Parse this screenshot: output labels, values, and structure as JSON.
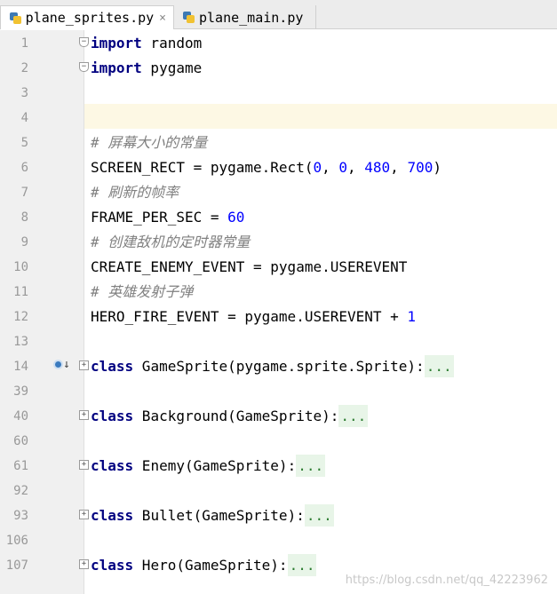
{
  "tabs": [
    {
      "label": "plane_sprites.py",
      "active": true,
      "closable": true,
      "icon": "python-file-icon"
    },
    {
      "label": "plane_main.py",
      "active": false,
      "closable": false,
      "icon": "python-file-icon"
    }
  ],
  "tab_close_glyph": "×",
  "lines": [
    {
      "n": "1",
      "text": "import random"
    },
    {
      "n": "2",
      "text": "import pygame"
    },
    {
      "n": "3",
      "text": ""
    },
    {
      "n": "4",
      "text": ""
    },
    {
      "n": "5",
      "text": "# 屏幕大小的常量"
    },
    {
      "n": "6",
      "text": "SCREEN_RECT = pygame.Rect(0, 0, 480, 700)"
    },
    {
      "n": "7",
      "text": "# 刷新的帧率"
    },
    {
      "n": "8",
      "text": "FRAME_PER_SEC = 60"
    },
    {
      "n": "9",
      "text": "# 创建敌机的定时器常量"
    },
    {
      "n": "10",
      "text": "CREATE_ENEMY_EVENT = pygame.USEREVENT"
    },
    {
      "n": "11",
      "text": "# 英雄发射子弹"
    },
    {
      "n": "12",
      "text": "HERO_FIRE_EVENT = pygame.USEREVENT + 1"
    },
    {
      "n": "13",
      "text": ""
    },
    {
      "n": "14",
      "text": "class GameSprite(pygame.sprite.Sprite):..."
    },
    {
      "n": "39",
      "text": ""
    },
    {
      "n": "40",
      "text": "class Background(GameSprite):..."
    },
    {
      "n": "60",
      "text": ""
    },
    {
      "n": "61",
      "text": "class Enemy(GameSprite):..."
    },
    {
      "n": "92",
      "text": ""
    },
    {
      "n": "93",
      "text": "class Bullet(GameSprite):..."
    },
    {
      "n": "106",
      "text": ""
    },
    {
      "n": "107",
      "text": "class Hero(GameSprite):..."
    }
  ],
  "watermark": "https://blog.csdn.net/qq_42223962",
  "colors": {
    "keyword": "#000080",
    "number": "#0000ff",
    "comment": "#808080",
    "caret_line": "#fdf8e4",
    "folded_region": "#e8f5e8"
  }
}
